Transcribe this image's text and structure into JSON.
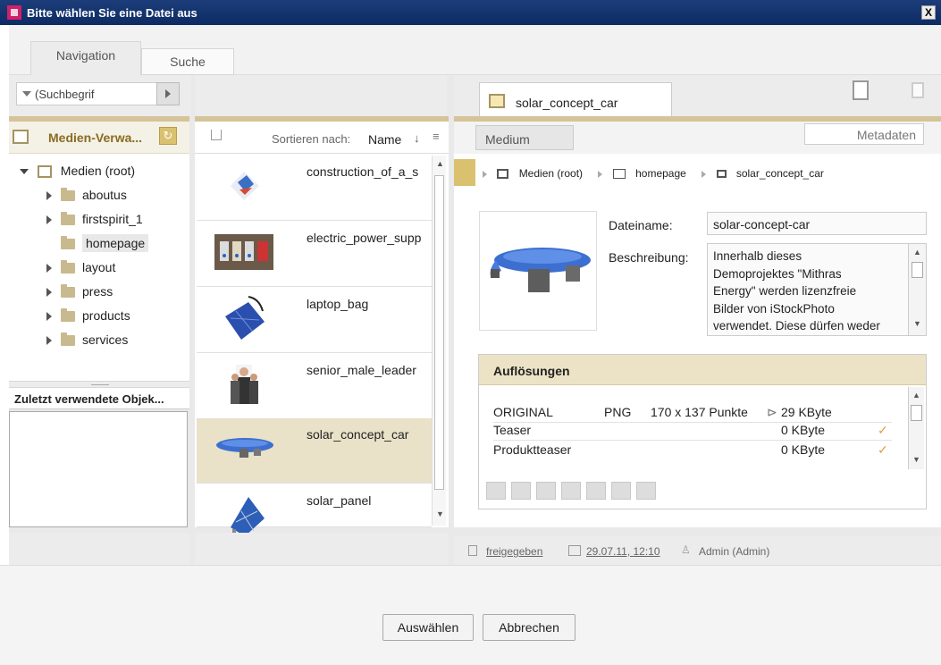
{
  "window": {
    "title": "Bitte wählen Sie eine Datei aus",
    "close_glyph": "X"
  },
  "tabs": [
    {
      "label": "Navigation"
    },
    {
      "label": "Suche"
    }
  ],
  "search": {
    "value": "(Suchbegrif"
  },
  "tree_header": {
    "label": "Medien-Verwa..."
  },
  "tree": {
    "root": "Medien (root)",
    "items": [
      {
        "label": "aboutus"
      },
      {
        "label": "firstspirit_1"
      },
      {
        "label": "homepage"
      },
      {
        "label": "layout"
      },
      {
        "label": "press"
      },
      {
        "label": "products"
      },
      {
        "label": "services"
      }
    ]
  },
  "recent": {
    "label": "Zuletzt verwendete Objek..."
  },
  "list_header": {
    "sort_label": "Sortieren nach:",
    "sort_value": "Name",
    "sort_dir_glyph": "↓"
  },
  "media_list": [
    {
      "name": "construction_of_a_s"
    },
    {
      "name": "electric_power_supp"
    },
    {
      "name": "laptop_bag"
    },
    {
      "name": "senior_male_leader"
    },
    {
      "name": "solar_concept_car"
    },
    {
      "name": "solar_panel"
    }
  ],
  "detail": {
    "tab_title": "solar_concept_car",
    "subtab_medium": "Medium",
    "subtab_metadata": "Metadaten",
    "breadcrumb": [
      "Medien (root)",
      "homepage",
      "solar_concept_car"
    ],
    "filename_label": "Dateiname:",
    "filename_value": "solar-concept-car",
    "description_label": "Beschreibung:",
    "description_lines": [
      "Innerhalb dieses",
      "Demoprojektes \"Mithras",
      "Energy\" werden lizenzfreie",
      "Bilder von iStockPhoto",
      "verwendet. Diese dürfen weder"
    ],
    "resolutions_title": "Auflösungen",
    "resolutions": [
      {
        "name": "ORIGINAL",
        "type": "PNG",
        "dims": "170 x 137 Punkte",
        "size": "29 KByte",
        "check": ""
      },
      {
        "name": "Teaser",
        "type": "",
        "dims": "",
        "size": "0 KByte",
        "check": "✓"
      },
      {
        "name": "Produktteaser",
        "type": "",
        "dims": "",
        "size": "0 KByte",
        "check": "✓"
      }
    ],
    "status": {
      "state": "freigegeben",
      "date": "29.07.11, 12:10",
      "user": "Admin (Admin)"
    }
  },
  "buttons": {
    "select": "Auswählen",
    "cancel": "Abbrechen"
  },
  "colors": {
    "title_bg": "#0d2b63",
    "accent_gold": "#d5c49a",
    "selection_bg": "#e9e1c8",
    "check": "#d9a441"
  }
}
